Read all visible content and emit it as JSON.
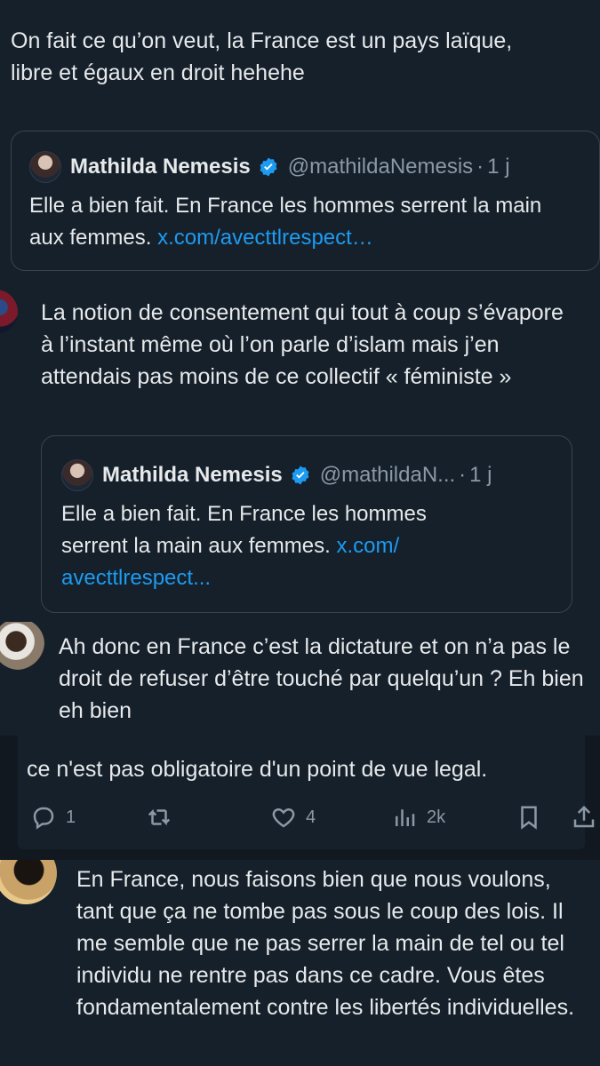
{
  "tweet1": {
    "text": "On fait ce qu’on veut, la France est un pays laïque, libre et égaux en droit hehehe",
    "quote": {
      "name": "Mathilda Nemesis",
      "handle": "@mathildaNemesis",
      "dot": "·",
      "time": "1 j",
      "text": "Elle a bien fait. En France les hommes serrent la main aux femmes.",
      "link": "x.com/avecttlrespect…"
    }
  },
  "tweet2": {
    "text": "La notion de consentement qui tout à coup s’évapore à l’instant même où l’on parle d’islam mais j’en attendais pas moins de ce collectif « féministe »",
    "quote": {
      "name": "Mathilda Nemesis",
      "handle": "@mathildaN...",
      "dot": "·",
      "time": "1 j",
      "text": "Elle a bien fait. En France les hommes serrent la main aux femmes.",
      "link_1": "x.com/",
      "link_2": "avecttlrespect..."
    }
  },
  "tweet3": {
    "text": "Ah donc en France c’est la dictature et on n’a pas le droit de refuser d’être touché par quelqu’un ? Eh bien eh bien"
  },
  "tweet4": {
    "text": "ce n'est pas obligatoire d'un point de vue legal.",
    "actions": {
      "reply_count": "1",
      "retweet_count": "",
      "like_count": "4",
      "views_count": "2k"
    }
  },
  "tweet5": {
    "text": "En France, nous faisons bien que nous voulons, tant que ça ne tombe pas sous le coup des lois. Il me semble que ne pas serrer la main de tel ou tel individu ne rentre pas dans ce cadre. Vous êtes fondamentalement contre les libertés individuelles."
  },
  "colors": {
    "background": "#15202b",
    "text": "#e7e9ea",
    "secondary": "#8b98a5",
    "link": "#1d9bf0",
    "verified": "#1d9bf0",
    "border": "#38444d"
  },
  "icons": [
    "verified-badge-icon",
    "reply-icon",
    "retweet-icon",
    "like-icon",
    "views-icon",
    "bookmark-icon",
    "share-icon"
  ]
}
